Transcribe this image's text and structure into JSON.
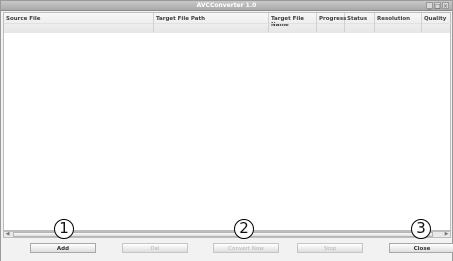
{
  "window": {
    "title": "AVCConverter 1.0",
    "controls": {
      "minimize": "_",
      "restore": "□",
      "close": "×"
    }
  },
  "table": {
    "columns": [
      "Source File",
      "Target File Path",
      "Target File Name",
      "Progress",
      "Status",
      "Resolution",
      "Quality"
    ]
  },
  "buttons": {
    "add": "Add",
    "del": "Del",
    "convert": "Convert Now",
    "stop": "Stop",
    "close": "Close"
  },
  "callouts": [
    "1",
    "2",
    "3"
  ]
}
